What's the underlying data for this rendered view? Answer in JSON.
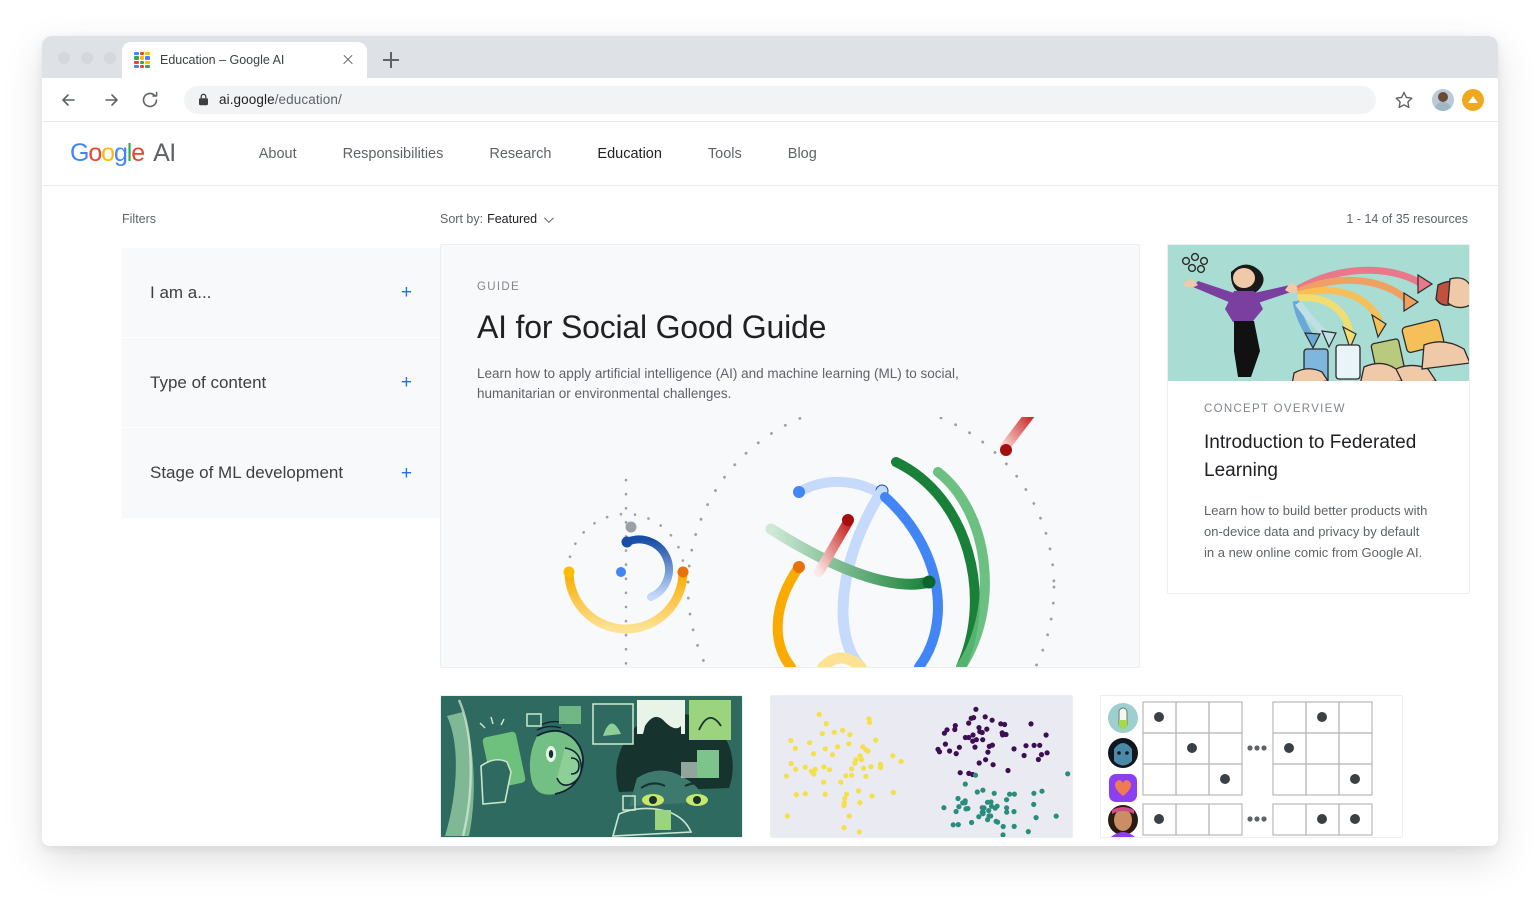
{
  "browser": {
    "tab": {
      "title": "Education – Google AI",
      "favicon": "google-ai-dots-favicon",
      "close": "×"
    },
    "new_tab_label": "+",
    "omnibox": {
      "lock_icon": "lock-icon",
      "url_bold": "ai.google",
      "url_dim": "/education/",
      "full_url": "ai.google/education/"
    },
    "back_icon": "back-arrow-icon",
    "forward_icon": "forward-arrow-icon",
    "reload_icon": "reload-icon",
    "star_icon": "bookmark-star-icon",
    "avatar_icon": "profile-avatar",
    "update_icon": "update-arrow-icon"
  },
  "site_nav": {
    "brand": {
      "google": "Google",
      "suffix": "AI"
    },
    "items": [
      {
        "label": "About",
        "active": false
      },
      {
        "label": "Responsibilities",
        "active": false
      },
      {
        "label": "Research",
        "active": false
      },
      {
        "label": "Education",
        "active": true
      },
      {
        "label": "Tools",
        "active": false
      },
      {
        "label": "Blog",
        "active": false
      }
    ]
  },
  "filters": {
    "heading": "Filters",
    "groups": [
      {
        "label": "I am a...",
        "expand": "+"
      },
      {
        "label": "Type of content",
        "expand": "+"
      },
      {
        "label": "Stage of ML development",
        "expand": "+"
      }
    ]
  },
  "results": {
    "sort_prefix": "Sort by:",
    "sort_value": "Featured",
    "sort_chevron": "chevron-down-icon",
    "count_text": "1 - 14 of 35 resources"
  },
  "cards": {
    "featured": {
      "eyebrow": "GUIDE",
      "title": "AI for Social Good Guide",
      "description": "Learn how to apply artificial intelligence (AI) and machine learning (ML) to social, humanitarian or environmental challenges.",
      "art": "google-ai-orbit-arcs-illustration"
    },
    "side": {
      "art": "federated-learning-comic-illustration",
      "eyebrow": "CONCEPT OVERVIEW",
      "title": "Introduction to Federated Learning",
      "description": "Learn how to build better products with on-device data and privacy by default in a new online comic from Google AI."
    },
    "row2": [
      {
        "art": "green-people-phones-illustration"
      },
      {
        "art": "scatter-plot-clusters-illustration"
      },
      {
        "art": "avatars-grid-matrix-illustration"
      }
    ]
  },
  "colors": {
    "blue": "#4285F4",
    "red": "#EA4335",
    "yellow": "#FBBC05",
    "green": "#34A853",
    "accent_link": "#1a73e8",
    "card_bg": "#f8f9fa",
    "text_primary": "#202124",
    "text_secondary": "#5f6368"
  }
}
